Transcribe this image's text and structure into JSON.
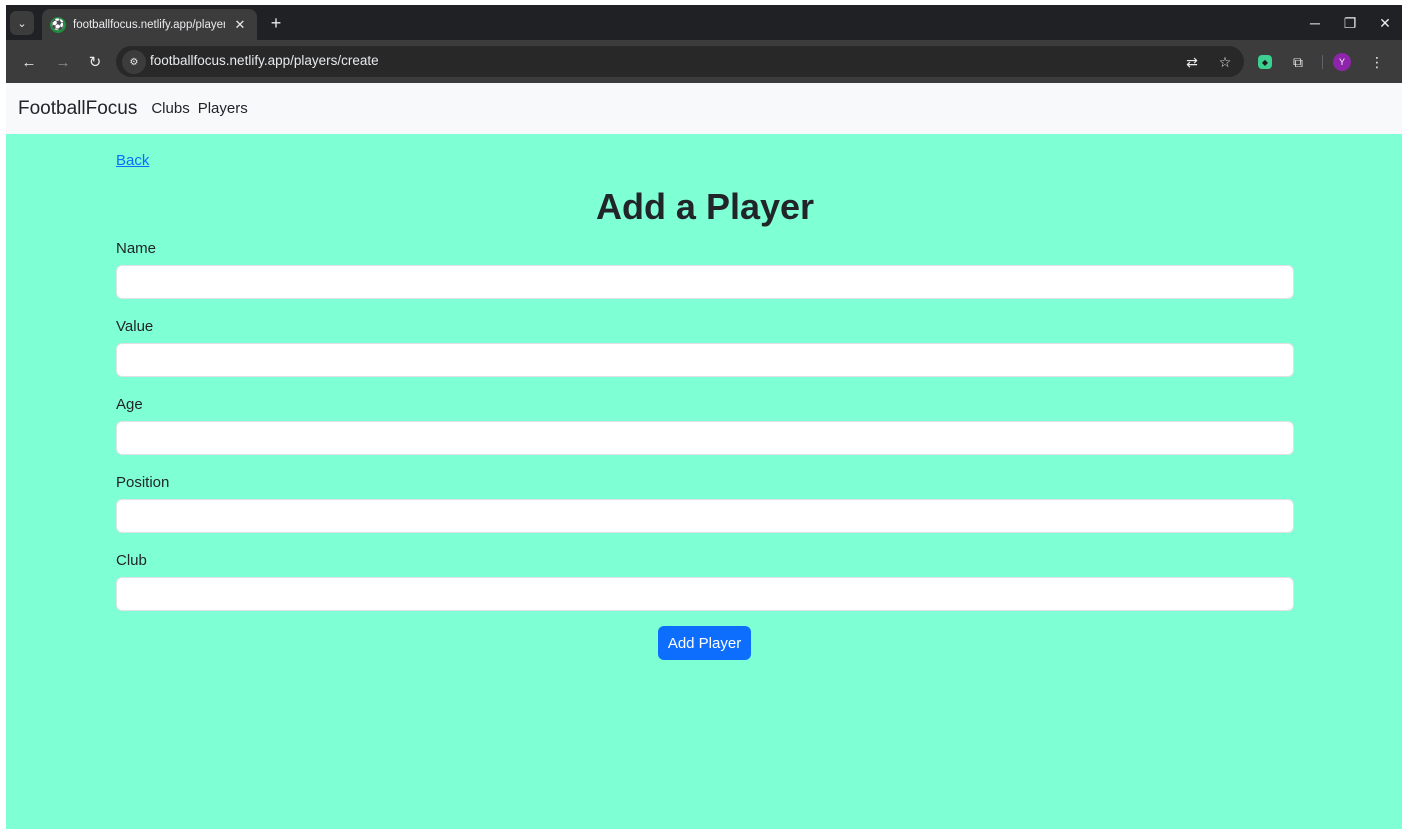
{
  "browser": {
    "tab_title": "footballfocus.netlify.app/player",
    "tab_close": "✕",
    "new_tab": "+",
    "url": "footballfocus.netlify.app/players/create",
    "profile_initial": "Y"
  },
  "navbar": {
    "brand": "FootballFocus",
    "links": [
      "Clubs",
      "Players"
    ]
  },
  "page": {
    "back_label": "Back",
    "title": "Add a Player",
    "fields": [
      {
        "label": "Name",
        "value": ""
      },
      {
        "label": "Value",
        "value": ""
      },
      {
        "label": "Age",
        "value": ""
      },
      {
        "label": "Position",
        "value": ""
      },
      {
        "label": "Club",
        "value": ""
      }
    ],
    "submit_label": "Add Player"
  },
  "colors": {
    "page_background": "#7fffd4",
    "navbar_background": "#f8f9fa",
    "primary_button": "#0d6efd",
    "link": "#0d6efd"
  }
}
